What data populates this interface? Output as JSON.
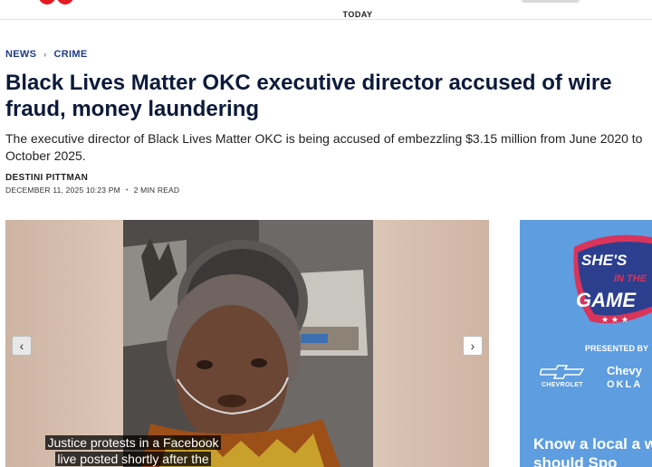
{
  "header": {
    "today_label": "TODAY"
  },
  "breadcrumb": {
    "items": [
      "NEWS",
      "CRIME"
    ],
    "separator": "›"
  },
  "article": {
    "headline": "Black Lives Matter OKC executive director accused of wire fraud, money laundering",
    "dek": "The executive director of Black Lives Matter OKC is being accused of embezzling $3.15 million from June 2020 to October 2025.",
    "author": "DESTINI PITTMAN",
    "date": "DECEMBER 11, 2025 10:23 PM",
    "read_time": "2 MIN READ"
  },
  "media": {
    "caption_line1": "Justice protests in a Facebook",
    "caption_line2": "live posted shortly after the",
    "prev_icon": "chevron-left-icon",
    "next_icon": "chevron-right-icon"
  },
  "ad": {
    "logo_line1": "SHE'S",
    "logo_line2": "IN THE",
    "logo_line3": "GAME",
    "presented_by": "PRESENTED BY",
    "chevy": "Chevy",
    "chevrolet": "CHEVROLET",
    "okla": "OKLA",
    "cta": "Know a local a we should Spo"
  },
  "colors": {
    "brand_red": "#e41b23",
    "headline_navy": "#0c1a3a",
    "breadcrumb_blue": "#1e3a8a",
    "ad_blue": "#5d9de0"
  }
}
